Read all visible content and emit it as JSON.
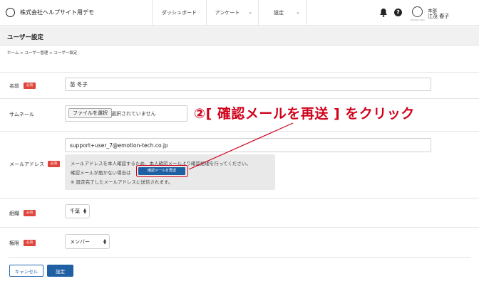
{
  "header": {
    "company": "株式会社ヘルプサイト用デモ",
    "nav": [
      {
        "label": "ダッシュボード",
        "dropdown": false
      },
      {
        "label": "アンケート",
        "dropdown": true
      },
      {
        "label": "設定",
        "dropdown": true
      }
    ],
    "help_glyph": "?",
    "user": {
      "department": "本部",
      "name": "江茂 春子",
      "avatar_caption": "Emotion Tech"
    }
  },
  "page": {
    "title": "ユーザー設定",
    "breadcrumb": "ホーム > ユーザー管理 > ユーザー設定"
  },
  "form": {
    "required_badge": "必須",
    "name": {
      "label": "名前",
      "value": "苗 冬子"
    },
    "thumbnail": {
      "label": "サムネール",
      "button": "ファイルを選択",
      "status": "選択されていません"
    },
    "email": {
      "label": "メールアドレス",
      "value": "support+user_7@emotion-tech.co.jp",
      "notice_line1": "メールアドレスを本人確認するため、本人確認メールより確認処理を行ってください。",
      "notice_line2": "確認メールが届かない場合は",
      "notice_line3": "※ 設定完了したメールアドレスに送信されます。",
      "resend_button": "確認メールを再送"
    },
    "organization": {
      "label": "組織",
      "value": "千葉"
    },
    "role": {
      "label": "権限",
      "value": "メンバー"
    }
  },
  "actions": {
    "cancel": "キャンセル",
    "save": "設定"
  },
  "annotation": {
    "text": "②[ 確認メールを再送 ] をクリック",
    "color": "#d0021b"
  },
  "colors": {
    "primary": "#1f5fa3",
    "required": "#e0463c",
    "annotation": "#d0021b"
  },
  "icons": {
    "bell": "bell-icon",
    "help": "help-icon",
    "chevron": "chevron-down-icon",
    "select": "select-arrows-icon"
  }
}
